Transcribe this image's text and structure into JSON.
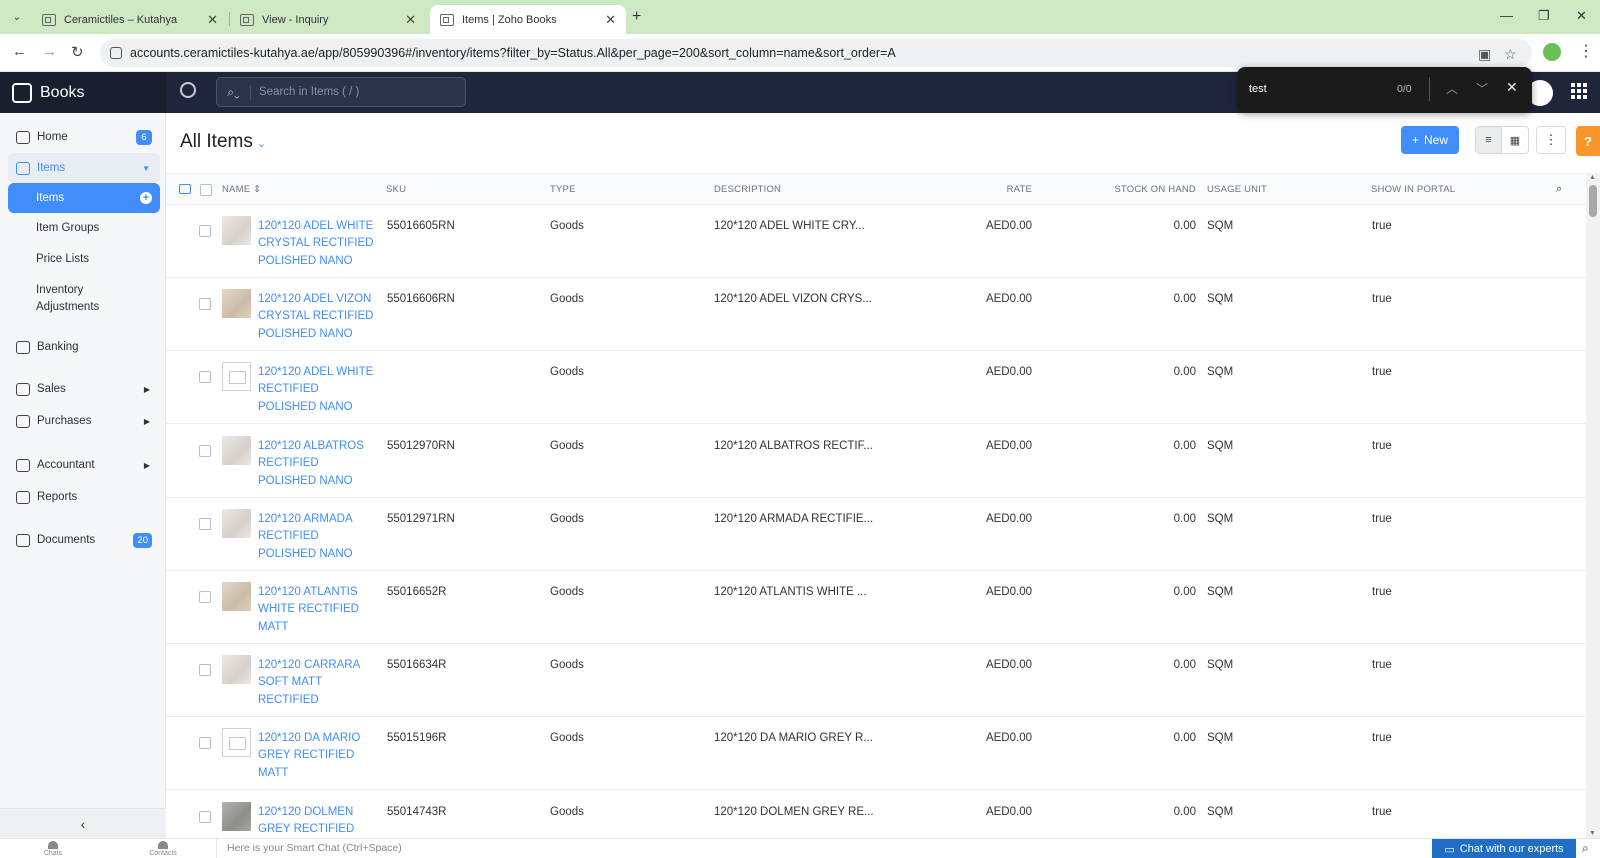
{
  "browser": {
    "tabs": [
      {
        "title": "Ceramictiles – Kutahya"
      },
      {
        "title": "View - Inquiry"
      },
      {
        "title": "Items | Zoho Books"
      }
    ],
    "url": "accounts.ceramictiles-kutahya.ae/app/805990396#/inventory/items?filter_by=Status.All&per_page=200&sort_column=name&sort_order=A"
  },
  "app": {
    "brand": "Books",
    "search_placeholder": "Search in Items ( / )"
  },
  "findbar": {
    "query": "test",
    "count": "0/0"
  },
  "sidebar": {
    "home": {
      "label": "Home",
      "badge": "6"
    },
    "items": {
      "label": "Items"
    },
    "sub": {
      "items": "Items",
      "item_groups": "Item Groups",
      "price_lists": "Price Lists",
      "inventory_line1": "Inventory",
      "inventory_line2": "Adjustments"
    },
    "banking": "Banking",
    "sales": "Sales",
    "purchases": "Purchases",
    "accountant": "Accountant",
    "reports": "Reports",
    "documents": {
      "label": "Documents",
      "badge": "20"
    }
  },
  "main": {
    "title": "All Items",
    "new_label": "New",
    "help": "?"
  },
  "table": {
    "headers": {
      "name": "NAME",
      "sku": "SKU",
      "type": "TYPE",
      "description": "DESCRIPTION",
      "rate": "RATE",
      "stock": "STOCK ON HAND",
      "unit": "USAGE UNIT",
      "portal": "SHOW IN PORTAL"
    },
    "rows": [
      {
        "name": "120*120 ADEL WHITE CRYSTAL RECTIFIED POLISHED NANO",
        "sku": "55016605RN",
        "type": "Goods",
        "description": "120*120 ADEL WHITE CRY...",
        "rate": "AED0.00",
        "stock": "0.00",
        "unit": "SQM",
        "portal": "true",
        "thumb": "marble"
      },
      {
        "name": "120*120 ADEL VIZON CRYSTAL RECTIFIED POLISHED NANO",
        "sku": "55016606RN",
        "type": "Goods",
        "description": "120*120 ADEL VIZON CRYS...",
        "rate": "AED0.00",
        "stock": "0.00",
        "unit": "SQM",
        "portal": "true",
        "thumb": "beige"
      },
      {
        "name": "120*120 ADEL WHITE RECTIFIED POLISHED NANO",
        "sku": "",
        "type": "Goods",
        "description": "",
        "rate": "AED0.00",
        "stock": "0.00",
        "unit": "SQM",
        "portal": "true",
        "thumb": "placeholder"
      },
      {
        "name": "120*120 ALBATROS RECTIFIED POLISHED NANO",
        "sku": "55012970RN",
        "type": "Goods",
        "description": "120*120 ALBATROS RECTIF...",
        "rate": "AED0.00",
        "stock": "0.00",
        "unit": "SQM",
        "portal": "true",
        "thumb": "marble"
      },
      {
        "name": "120*120 ARMADA RECTIFIED POLISHED NANO",
        "sku": "55012971RN",
        "type": "Goods",
        "description": "120*120 ARMADA RECTIFIE...",
        "rate": "AED0.00",
        "stock": "0.00",
        "unit": "SQM",
        "portal": "true",
        "thumb": "marble"
      },
      {
        "name": "120*120 ATLANTIS WHITE RECTIFIED MATT",
        "sku": "55016652R",
        "type": "Goods",
        "description": "120*120 ATLANTIS WHITE ...",
        "rate": "AED0.00",
        "stock": "0.00",
        "unit": "SQM",
        "portal": "true",
        "thumb": "beige"
      },
      {
        "name": "120*120 CARRARA SOFT MATT RECTIFIED",
        "sku": "55016634R",
        "type": "Goods",
        "description": "",
        "rate": "AED0.00",
        "stock": "0.00",
        "unit": "SQM",
        "portal": "true",
        "thumb": "marble"
      },
      {
        "name": "120*120 DA MARIO GREY RECTIFIED MATT",
        "sku": "55015196R",
        "type": "Goods",
        "description": "120*120 DA MARIO GREY R...",
        "rate": "AED0.00",
        "stock": "0.00",
        "unit": "SQM",
        "portal": "true",
        "thumb": "placeholder"
      },
      {
        "name": "120*120 DOLMEN GREY RECTIFIED",
        "sku": "55014743R",
        "type": "Goods",
        "description": "120*120 DOLMEN GREY RE...",
        "rate": "AED0.00",
        "stock": "0.00",
        "unit": "SQM",
        "portal": "true",
        "thumb": "grey"
      }
    ]
  },
  "bottom": {
    "chats": "Chats",
    "contacts": "Contacts",
    "smart_chat_placeholder": "Here is your Smart Chat (Ctrl+Space)",
    "chat_experts": "Chat with our experts"
  },
  "colors": {
    "accent": "#408dfb",
    "topbar": "#20263a",
    "tabstrip": "#cfe8c4",
    "help": "#f8962d"
  }
}
